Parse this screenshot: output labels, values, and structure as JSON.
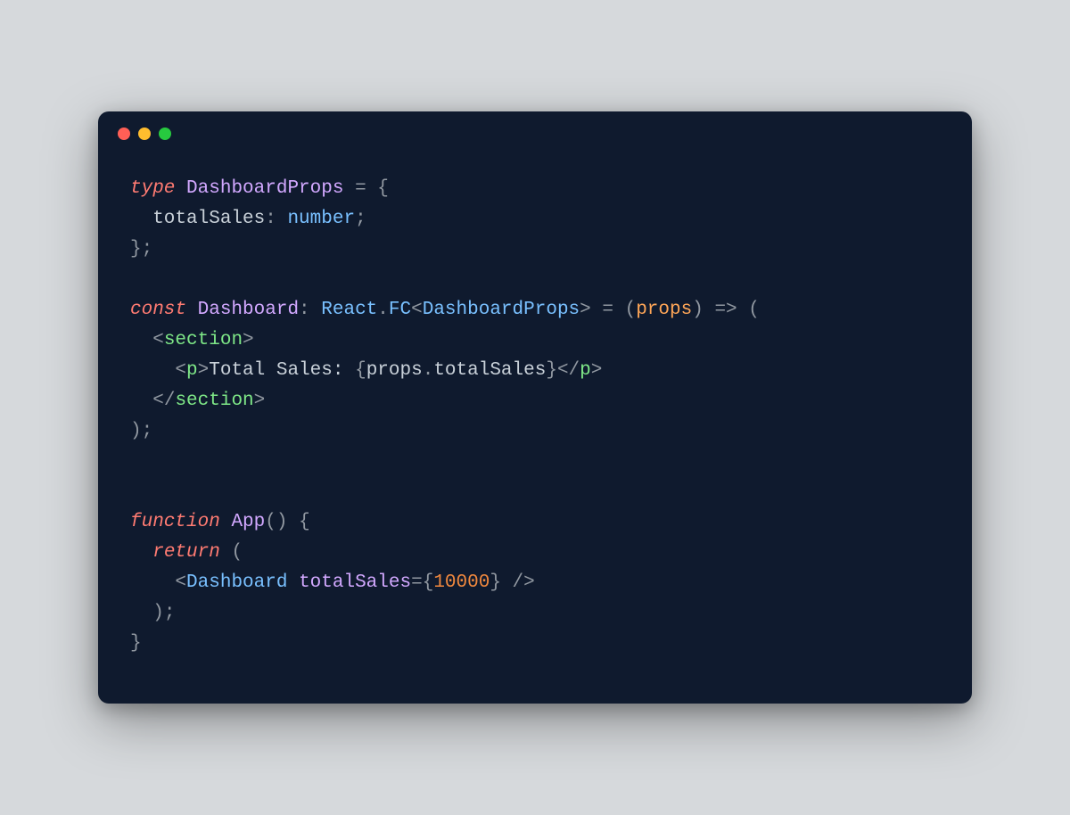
{
  "window": {
    "controls": [
      "close",
      "minimize",
      "zoom"
    ]
  },
  "code": {
    "lines": [
      [
        {
          "t": "type",
          "c": "keyword"
        },
        {
          "t": " ",
          "c": "plain"
        },
        {
          "t": "DashboardProps",
          "c": "entity"
        },
        {
          "t": " ",
          "c": "plain"
        },
        {
          "t": "=",
          "c": "punct"
        },
        {
          "t": " ",
          "c": "plain"
        },
        {
          "t": "{",
          "c": "punct"
        }
      ],
      [
        {
          "t": "  totalSales",
          "c": "plain"
        },
        {
          "t": ":",
          "c": "punct"
        },
        {
          "t": " ",
          "c": "plain"
        },
        {
          "t": "number",
          "c": "type"
        },
        {
          "t": ";",
          "c": "punct"
        }
      ],
      [
        {
          "t": "}",
          "c": "punct"
        },
        {
          "t": ";",
          "c": "punct"
        }
      ],
      [
        {
          "t": "",
          "c": "plain"
        }
      ],
      [
        {
          "t": "const",
          "c": "keyword"
        },
        {
          "t": " ",
          "c": "plain"
        },
        {
          "t": "Dashboard",
          "c": "entity"
        },
        {
          "t": ":",
          "c": "punct"
        },
        {
          "t": " ",
          "c": "plain"
        },
        {
          "t": "React",
          "c": "type"
        },
        {
          "t": ".",
          "c": "punct"
        },
        {
          "t": "FC",
          "c": "type"
        },
        {
          "t": "<",
          "c": "punct"
        },
        {
          "t": "DashboardProps",
          "c": "type"
        },
        {
          "t": ">",
          "c": "punct"
        },
        {
          "t": " ",
          "c": "plain"
        },
        {
          "t": "=",
          "c": "punct"
        },
        {
          "t": " ",
          "c": "plain"
        },
        {
          "t": "(",
          "c": "punct"
        },
        {
          "t": "props",
          "c": "variable"
        },
        {
          "t": ")",
          "c": "punct"
        },
        {
          "t": " ",
          "c": "plain"
        },
        {
          "t": "=>",
          "c": "punct"
        },
        {
          "t": " ",
          "c": "plain"
        },
        {
          "t": "(",
          "c": "punct"
        }
      ],
      [
        {
          "t": "  ",
          "c": "plain"
        },
        {
          "t": "<",
          "c": "punct"
        },
        {
          "t": "section",
          "c": "prop"
        },
        {
          "t": ">",
          "c": "punct"
        }
      ],
      [
        {
          "t": "    ",
          "c": "plain"
        },
        {
          "t": "<",
          "c": "punct"
        },
        {
          "t": "p",
          "c": "prop"
        },
        {
          "t": ">",
          "c": "punct"
        },
        {
          "t": "Total Sales: ",
          "c": "plain"
        },
        {
          "t": "{",
          "c": "punct"
        },
        {
          "t": "props",
          "c": "plain"
        },
        {
          "t": ".",
          "c": "punct"
        },
        {
          "t": "totalSales",
          "c": "plain"
        },
        {
          "t": "}",
          "c": "punct"
        },
        {
          "t": "</",
          "c": "punct"
        },
        {
          "t": "p",
          "c": "prop"
        },
        {
          "t": ">",
          "c": "punct"
        }
      ],
      [
        {
          "t": "  ",
          "c": "plain"
        },
        {
          "t": "</",
          "c": "punct"
        },
        {
          "t": "section",
          "c": "prop"
        },
        {
          "t": ">",
          "c": "punct"
        }
      ],
      [
        {
          "t": ")",
          "c": "punct"
        },
        {
          "t": ";",
          "c": "punct"
        }
      ],
      [
        {
          "t": "",
          "c": "plain"
        }
      ],
      [
        {
          "t": "",
          "c": "plain"
        }
      ],
      [
        {
          "t": "function",
          "c": "keyword"
        },
        {
          "t": " ",
          "c": "plain"
        },
        {
          "t": "App",
          "c": "entity"
        },
        {
          "t": "()",
          "c": "punct"
        },
        {
          "t": " ",
          "c": "plain"
        },
        {
          "t": "{",
          "c": "punct"
        }
      ],
      [
        {
          "t": "  ",
          "c": "plain"
        },
        {
          "t": "return",
          "c": "keyword"
        },
        {
          "t": " ",
          "c": "plain"
        },
        {
          "t": "(",
          "c": "punct"
        }
      ],
      [
        {
          "t": "    ",
          "c": "plain"
        },
        {
          "t": "<",
          "c": "punct"
        },
        {
          "t": "Dashboard",
          "c": "type"
        },
        {
          "t": " ",
          "c": "plain"
        },
        {
          "t": "totalSales",
          "c": "entity"
        },
        {
          "t": "=",
          "c": "punct"
        },
        {
          "t": "{",
          "c": "punct"
        },
        {
          "t": "10000",
          "c": "number"
        },
        {
          "t": "}",
          "c": "punct"
        },
        {
          "t": " ",
          "c": "plain"
        },
        {
          "t": "/>",
          "c": "punct"
        }
      ],
      [
        {
          "t": "  ",
          "c": "plain"
        },
        {
          "t": ")",
          "c": "punct"
        },
        {
          "t": ";",
          "c": "punct"
        }
      ],
      [
        {
          "t": "}",
          "c": "punct"
        }
      ]
    ]
  }
}
